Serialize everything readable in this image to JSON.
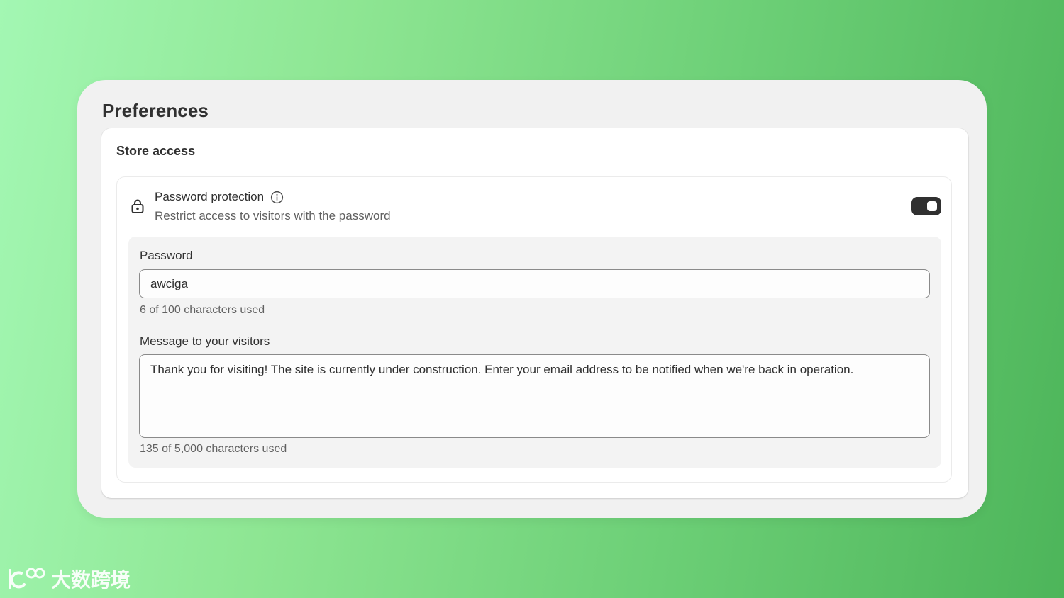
{
  "page": {
    "title": "Preferences"
  },
  "store_access": {
    "section_title": "Store access",
    "password_protection": {
      "label": "Password protection",
      "description": "Restrict access to visitors with the password",
      "enabled": true,
      "icon": "lock-icon",
      "info_icon": "info-icon"
    },
    "password_field": {
      "label": "Password",
      "value": "awciga",
      "helper": "6 of 100 characters used"
    },
    "message_field": {
      "label": "Message to your visitors",
      "value": "Thank you for visiting! The site is currently under construction. Enter your email address to be notified when we're back in operation.",
      "helper": "135 of 5,000 characters used"
    }
  },
  "watermark": {
    "text": "大数跨境"
  },
  "colors": {
    "toggle_on": "#303030",
    "card_bg": "#f1f1f1",
    "panel_bg": "#f3f3f3",
    "gradient_start": "#a3f7b3",
    "gradient_end": "#4db55a"
  }
}
